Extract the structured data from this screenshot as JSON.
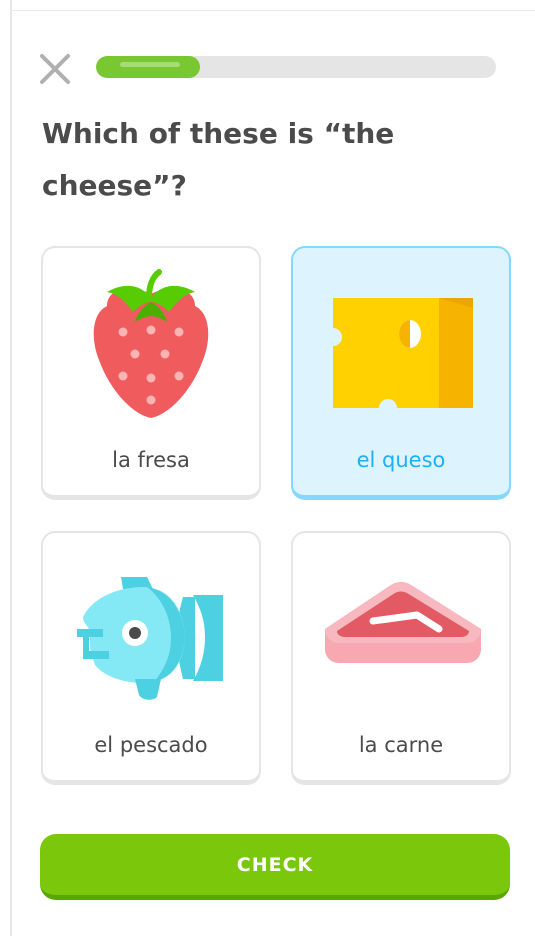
{
  "header": {
    "close_icon": "close-icon",
    "progress_fraction": 0.26
  },
  "question": {
    "text": "Which of these is “the cheese”?"
  },
  "choices": [
    {
      "label": "la fresa",
      "icon": "strawberry-icon",
      "selected": false
    },
    {
      "label": "el queso",
      "icon": "cheese-icon",
      "selected": true
    },
    {
      "label": "el pescado",
      "icon": "fish-icon",
      "selected": false
    },
    {
      "label": "la carne",
      "icon": "meat-icon",
      "selected": false
    }
  ],
  "footer": {
    "check_label": "CHECK"
  },
  "colors": {
    "progress": "#79c832",
    "selected_border": "#84d8ff",
    "selected_bg": "#ddf4ff",
    "selected_text": "#1cb0f6",
    "check_button": "#7ac70c",
    "text": "#4b4b4b"
  }
}
